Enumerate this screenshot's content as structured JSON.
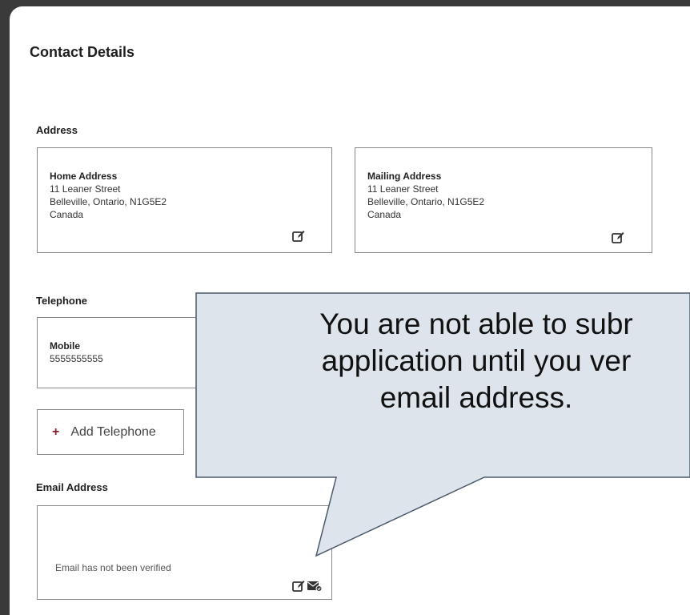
{
  "page": {
    "title": "Contact Details"
  },
  "address": {
    "section_label": "Address",
    "home": {
      "label": "Home Address",
      "street": "11 Leaner Street",
      "city_line": "Belleville, Ontario, N1G5E2",
      "country": "Canada"
    },
    "mailing": {
      "label": "Mailing Address",
      "street": "11 Leaner Street",
      "city_line": "Belleville, Ontario, N1G5E2",
      "country": "Canada"
    }
  },
  "telephone": {
    "section_label": "Telephone",
    "mobile": {
      "label": "Mobile",
      "number": "5555555555"
    },
    "add_button": {
      "icon": "plus-icon",
      "label": "Add Telephone"
    }
  },
  "email": {
    "section_label": "Email Address",
    "status": "Email has not been verified"
  },
  "callout": {
    "line1": "You are not able to subr",
    "line2": "application until you ver",
    "line3": "email address."
  },
  "colors": {
    "background_dark": "#3a3a3a",
    "callout_fill": "#dde4ec",
    "callout_border": "#4a5a6a",
    "accent_plus": "#8b1d2c"
  }
}
